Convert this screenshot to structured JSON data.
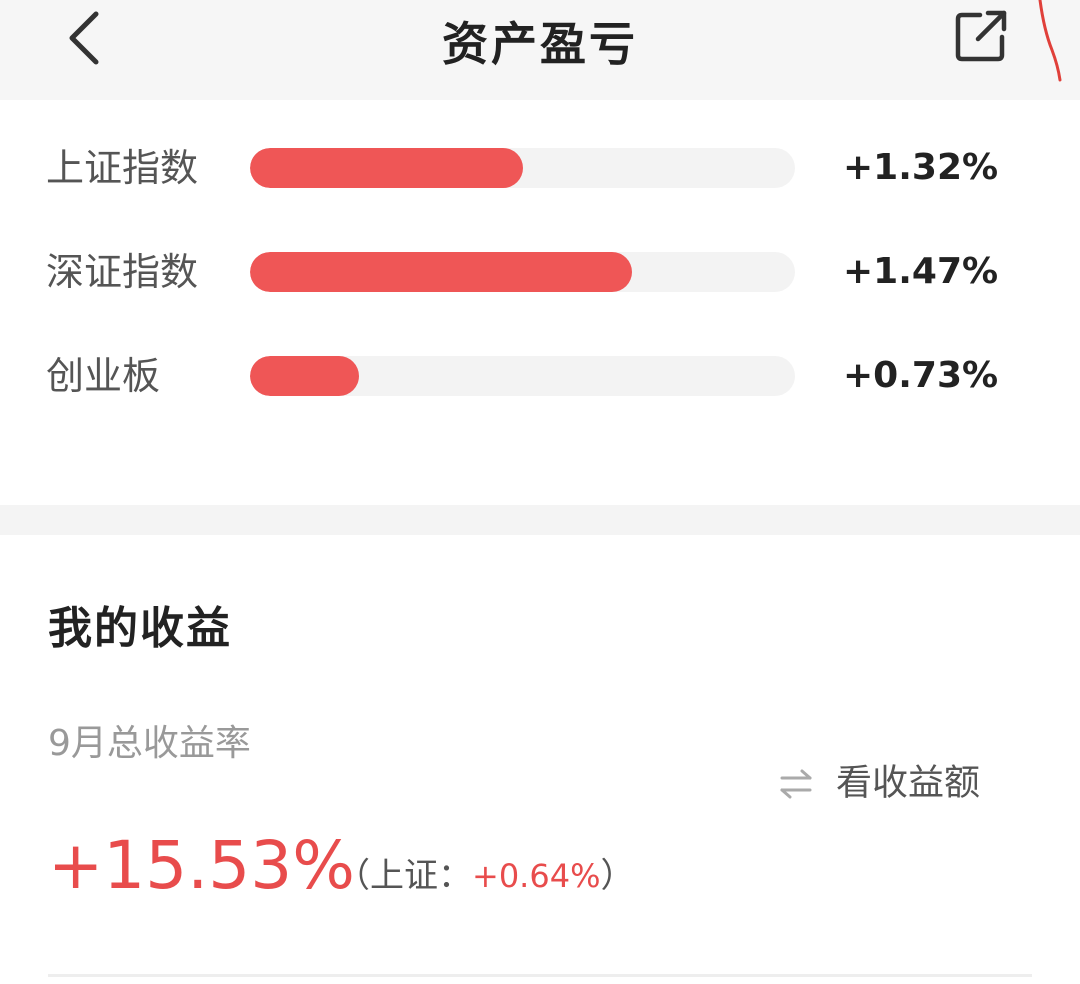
{
  "header": {
    "title": "资产盈亏"
  },
  "indices": [
    {
      "name": "上证指数",
      "change": "+1.32%",
      "progress": 0.5
    },
    {
      "name": "深证指数",
      "change": "+1.47%",
      "progress": 0.7
    },
    {
      "name": "创业板",
      "change": "+0.73%",
      "progress": 0.2
    }
  ],
  "earnings": {
    "section_title": "我的收益",
    "rate_label": "9月总收益率",
    "toggle_label": "看收益额",
    "rate_value": "+15.53%",
    "compare_open": "（",
    "compare_label": "上证：",
    "compare_value": "+0.64%",
    "compare_close": "）"
  },
  "colors": {
    "accent_red": "#ef5656",
    "text_red": "#e84c4c"
  },
  "icons": {
    "back": "chevron-left-icon",
    "share": "share-external-icon",
    "swap": "swap-arrows-icon"
  }
}
